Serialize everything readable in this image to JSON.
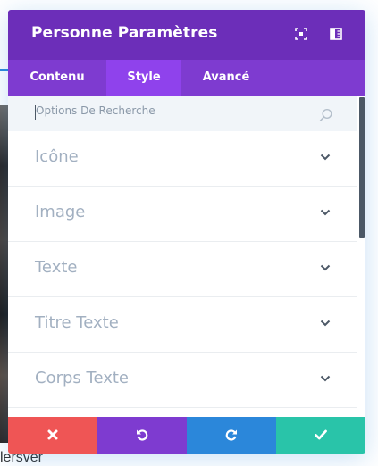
{
  "background": {
    "text": "lersver"
  },
  "modal": {
    "title": "Personne Paramètres",
    "header_icons": [
      "expand-icon",
      "split-view-icon"
    ],
    "tabs": [
      {
        "label": "Contenu",
        "active": false
      },
      {
        "label": "Style",
        "active": true
      },
      {
        "label": "Avancé",
        "active": false
      }
    ],
    "search": {
      "placeholder": "Options De Recherche",
      "value": ""
    },
    "sections": [
      {
        "label": "Icône"
      },
      {
        "label": "Image"
      },
      {
        "label": "Texte"
      },
      {
        "label": "Titre Texte"
      },
      {
        "label": "Corps Texte"
      }
    ],
    "footer": {
      "buttons": [
        "close-icon",
        "undo-icon",
        "redo-icon",
        "check-icon"
      ]
    }
  },
  "colors": {
    "header": "#6c2eb9",
    "tabs": "#7e3bd0",
    "active_tab": "#8f42ec",
    "discard": "#ef5555",
    "undo": "#7e3bd0",
    "redo": "#2b87da",
    "save": "#29c4a9"
  }
}
